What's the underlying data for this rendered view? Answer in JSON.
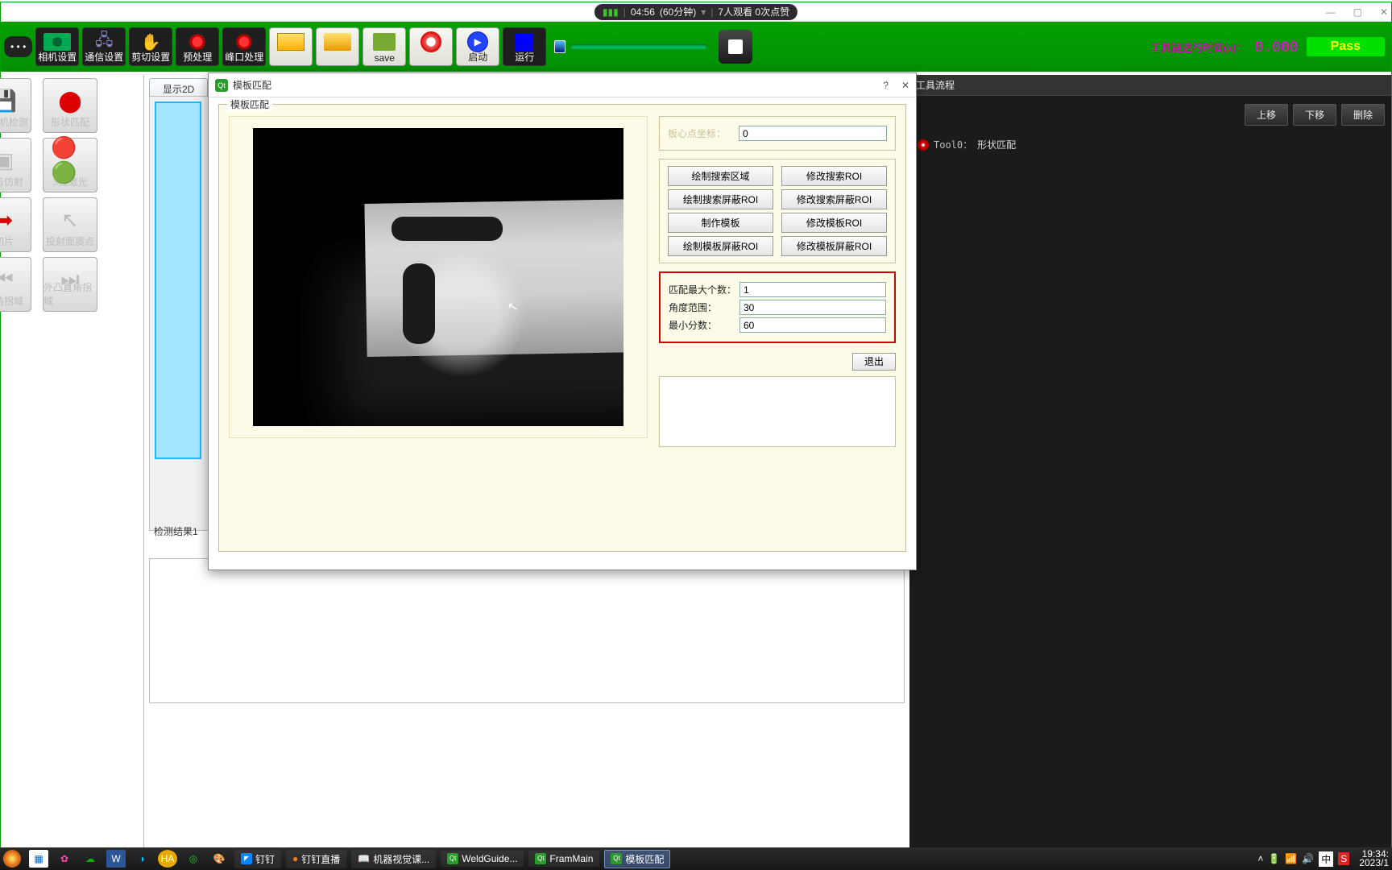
{
  "title_bar": {
    "time": "04:56",
    "duration": "(60分钟)",
    "viewers": "7人观看 0次点赞"
  },
  "toolbar": {
    "camera": "相机设置",
    "comm": "通信设置",
    "crop": "剪切设置",
    "pre": "预处理",
    "peak": "峰口处理",
    "save": "save",
    "start": "启动",
    "run": "运行"
  },
  "status": {
    "label": "工具链运行时间(s)：",
    "value": "0.000",
    "pass": "Pass"
  },
  "palette": {
    "p1a": "图相机检测",
    "p1b": "形状匹配",
    "p2a": "化与仿射",
    "p2b": "3线激光",
    "p3a": "切片",
    "p3b": "投射面质点",
    "p4a": "直角拐域",
    "p4b": "外凸直角拐域"
  },
  "tabs": {
    "t1": "显示2D"
  },
  "center": {
    "results_label": "检测结果1"
  },
  "right": {
    "head": "工具流程",
    "up": "上移",
    "down": "下移",
    "del": "删除",
    "tool_id": "Tool0：",
    "tool_name": "形状匹配"
  },
  "modal": {
    "title": "模板匹配",
    "legend": "模板匹配",
    "r1_label": "板心点坐标：",
    "r1_val": "0",
    "btns": {
      "b1": "绘制搜索区域",
      "b2": "修改搜索ROI",
      "b3": "绘制搜索屏蔽ROI",
      "b4": "修改搜索屏蔽ROI",
      "b5": "制作模板",
      "b6": "修改模板ROI",
      "b7": "绘制模板屏蔽ROI",
      "b8": "修改模板屏蔽ROI"
    },
    "p_max_label": "匹配最大个数：",
    "p_max_val": "1",
    "p_angle_label": "角度范围：",
    "p_angle_val": "30",
    "p_score_label": "最小分数：",
    "p_score_val": "60",
    "exit": "退出"
  },
  "taskbar": {
    "dd": "钉钉",
    "ddlive": "钉钉直播",
    "mvclass": "机器视觉课...",
    "weld": "WeldGuide...",
    "framm": "FramMain",
    "match": "模板匹配",
    "ime": "中",
    "time": "19:34:",
    "date": "2023/1"
  }
}
